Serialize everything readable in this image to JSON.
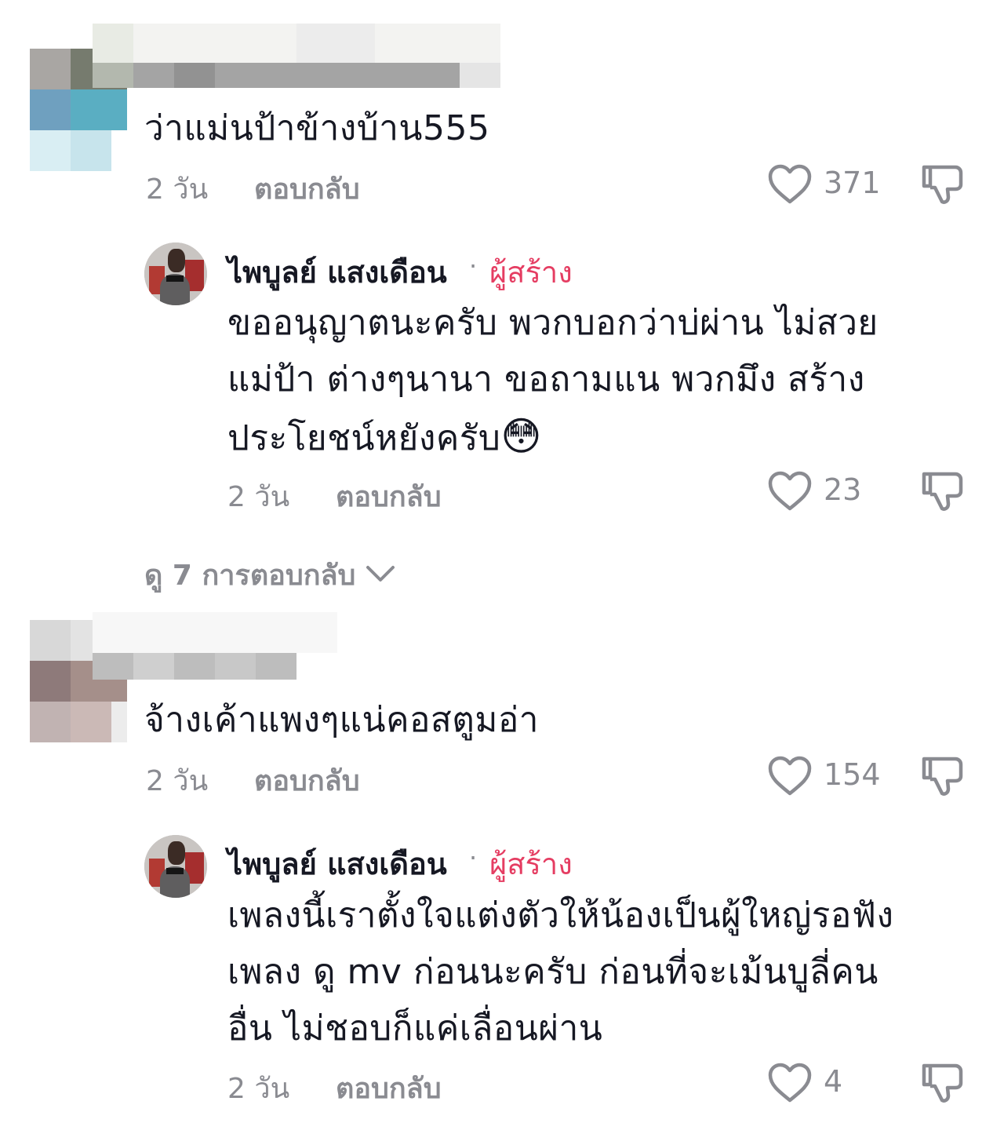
{
  "comments": [
    {
      "text": "ว่าแม่นป้าข้างบ้าน555",
      "time": "2 วัน",
      "reply_label": "ตอบกลับ",
      "likes": "371"
    },
    {
      "text": "จ้างเค้าแพงๆแน่คอสตูมอ่า",
      "time": "2 วัน",
      "reply_label": "ตอบกลับ",
      "likes": "154"
    }
  ],
  "replies": [
    {
      "author": "ไพบูลย์ แสงเดือน",
      "separator": "·",
      "badge": "ผู้สร้าง",
      "lines": [
        "ขออนุญาตนะครับ พวกบอกว่าบ่ผ่าน ไม่สวย",
        "แม่ป้า ต่างๆนานา ขอถามแน พวกมึง สร้าง",
        "ประโยชน์หยังครับ"
      ],
      "emoji": "😳",
      "time": "2 วัน",
      "reply_label": "ตอบกลับ",
      "likes": "23"
    },
    {
      "author": "ไพบูลย์ แสงเดือน",
      "separator": "·",
      "badge": "ผู้สร้าง",
      "lines": [
        "เพลงนี้เราตั้งใจแต่งตัวให้น้องเป็นผู้ใหญ่รอฟัง",
        "เพลง ดู mv ก่อนนะครับ ก่อนที่จะเม้นบูลี่คน",
        "อื่น ไม่ชอบก็แค่เลื่อนผ่าน"
      ],
      "time": "2 วัน",
      "reply_label": "ตอบกลับ",
      "likes": "4"
    }
  ],
  "view_replies": "ดู 7 การตอบกลับ",
  "icons": {
    "like": "heart-icon",
    "dislike": "thumbs-down-icon",
    "expand": "chevron-down-icon"
  },
  "colors": {
    "text": "#161823",
    "muted": "#8a8b91",
    "creator_badge": "#e53d62"
  }
}
